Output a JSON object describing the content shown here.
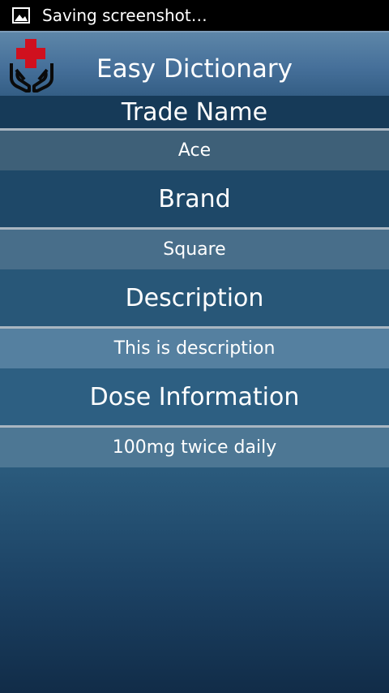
{
  "status_bar": {
    "notification_icon": "image-icon",
    "text": "Saving screenshot…"
  },
  "header": {
    "logo_icon": "medical-cross-hands-icon",
    "title": "Easy Dictionary"
  },
  "details": {
    "trade_name": {
      "label": "Trade Name",
      "value": "Ace"
    },
    "brand": {
      "label": "Brand",
      "value": "Square"
    },
    "description": {
      "label": "Description",
      "value": "This is description"
    },
    "dose_information": {
      "label": "Dose Information",
      "value": "100mg twice daily"
    }
  },
  "colors": {
    "logo_cross": "#d0101e",
    "header_top": "#5d86a8",
    "background_dark": "#112c48"
  }
}
